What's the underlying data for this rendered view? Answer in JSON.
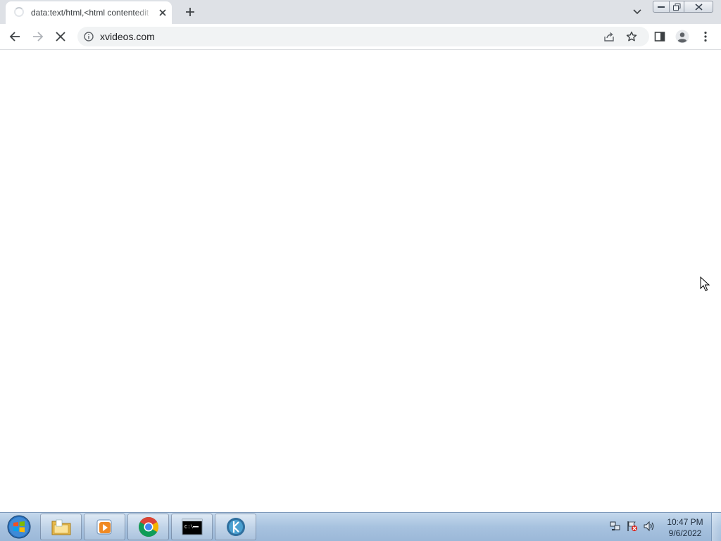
{
  "browser": {
    "tab": {
      "title": "data:text/html,<html contentedit",
      "loading": true
    },
    "address_bar": {
      "url": "xvideos.com",
      "info_icon": "info-icon"
    },
    "icons": {
      "back": "back-arrow-icon",
      "forward": "forward-arrow-icon",
      "stop": "stop-loading-icon",
      "share": "share-icon",
      "bookmark": "star-icon",
      "side_panel": "side-panel-icon",
      "profile": "profile-icon",
      "menu": "kebab-menu-icon"
    }
  },
  "taskbar": {
    "items": [
      "file-explorer",
      "windows-media-player",
      "google-chrome",
      "command-prompt",
      "app-k"
    ],
    "clock": {
      "time": "10:47 PM",
      "date": "9/6/2022"
    }
  },
  "colors": {
    "tabstrip": "#dee1e6",
    "omnibox": "#f1f3f4",
    "taskbar": "#a7c2df"
  }
}
